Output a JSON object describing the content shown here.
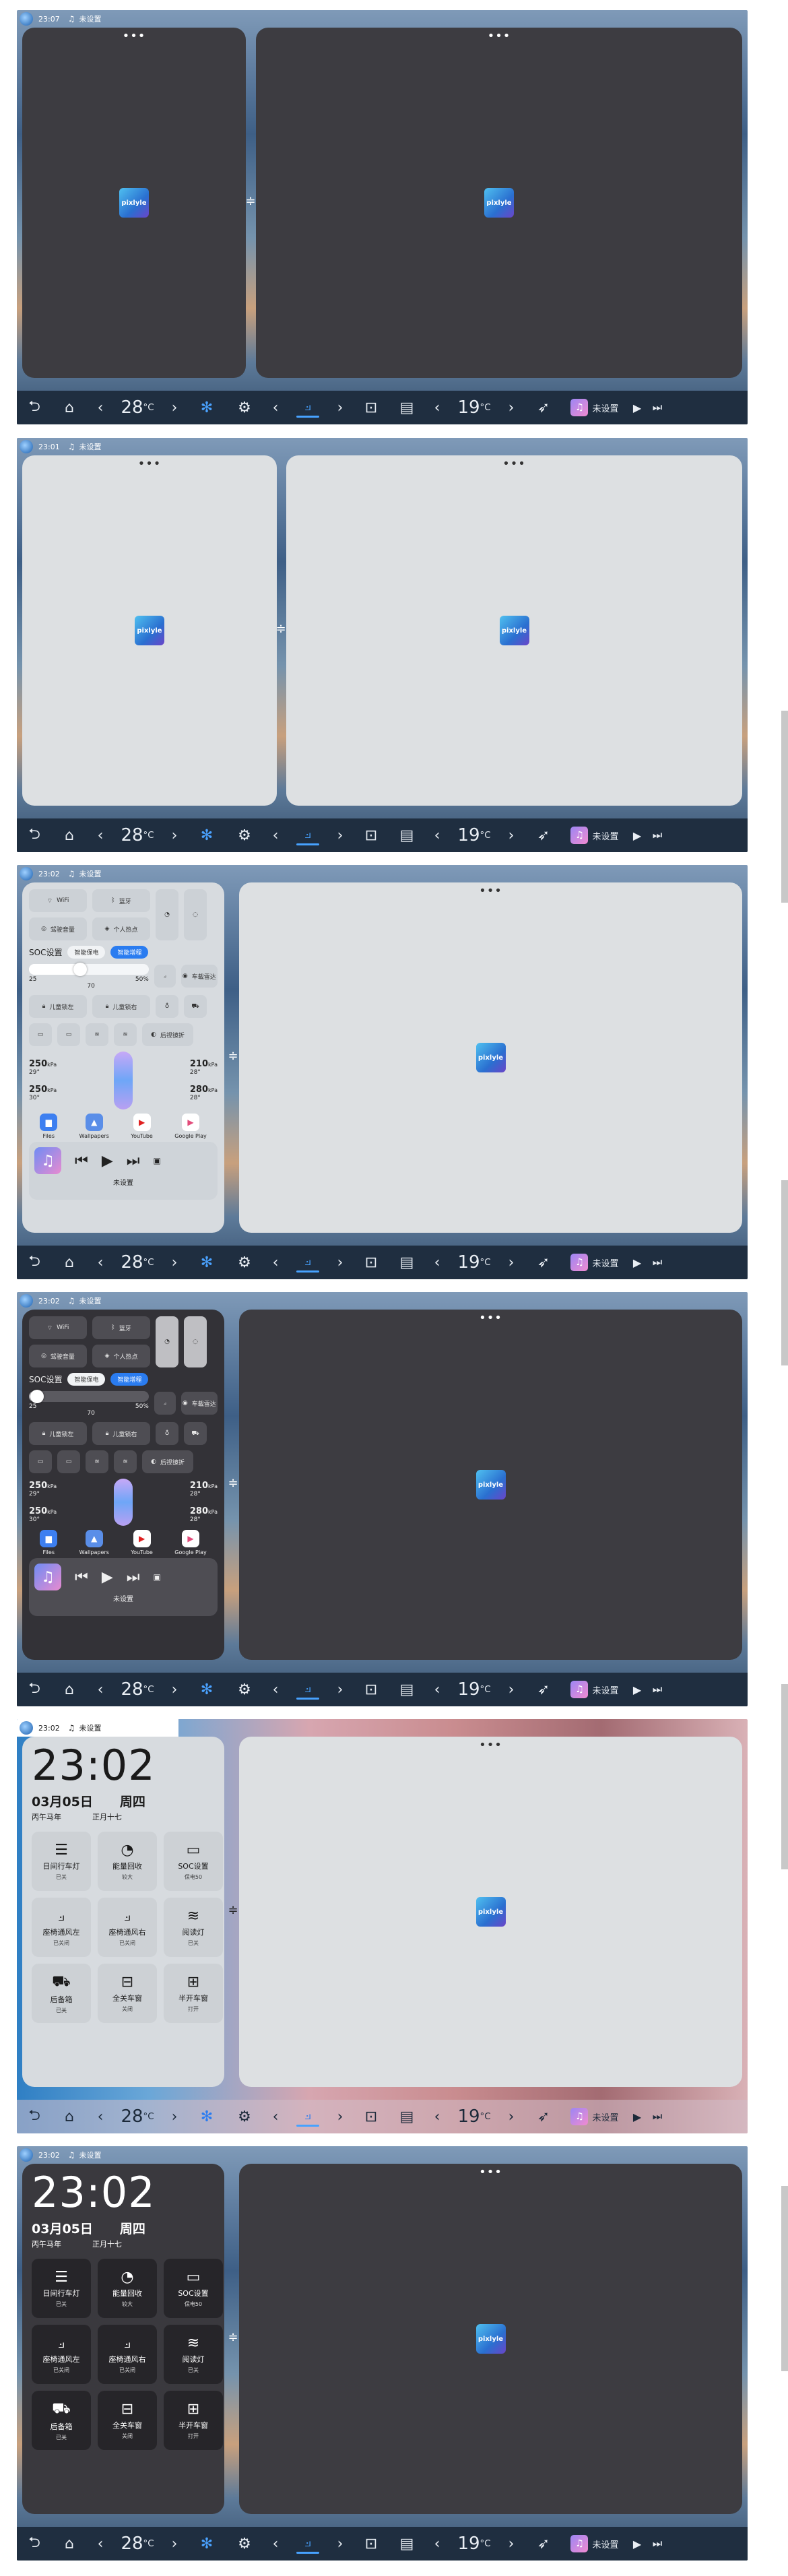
{
  "status": {
    "times": [
      "23:07",
      "23:01",
      "23:02",
      "23:02",
      "23:02",
      "23:02"
    ],
    "music_label": "未设置"
  },
  "app": {
    "icon_label": "pixlyle"
  },
  "divider": {
    "glyph": "≑"
  },
  "navbar": {
    "left_temp": "28",
    "right_temp": "19",
    "unit": "°C",
    "media_label": "未设置"
  },
  "quick": {
    "wifi": "WiFi",
    "bluetooth": "蓝牙",
    "t2": "驾驶音量",
    "t3": "个人热点",
    "soc_title": "SOC设置",
    "soc_opt1": "智能保电",
    "soc_opt2": "智能增程",
    "soc_value": "50%",
    "soc_min": "25",
    "soc_max": "70",
    "t4": "车载雷达",
    "child1": "儿童锁左",
    "child2": "儿童锁右",
    "t5": "后视镜折",
    "tyres": {
      "fl": "250",
      "fl_t": "29°",
      "fr": "210",
      "fr_t": "28°",
      "rl": "250",
      "rl_t": "30°",
      "rr": "280",
      "rr_t": "28°",
      "unit": "kPa"
    },
    "apps": [
      "Files",
      "Wallpapers",
      "YouTube",
      "Google Play"
    ],
    "media_caption": "未设置"
  },
  "clock": {
    "time": "23:02",
    "date": "03月05日",
    "weekday": "周四",
    "year": "丙午马年",
    "lunar": "正月十七",
    "tiles": [
      {
        "label": "日间行车灯",
        "sub": "已关"
      },
      {
        "label": "能量回收",
        "sub": "较大"
      },
      {
        "label": "SOC设置",
        "sub": "保电50"
      },
      {
        "label": "座椅通风左",
        "sub": "已关闭"
      },
      {
        "label": "座椅通风右",
        "sub": "已关闭"
      },
      {
        "label": "阅读灯",
        "sub": "已关"
      },
      {
        "label": "后备箱",
        "sub": "已关"
      },
      {
        "label": "全关车窗",
        "sub": "关闭"
      },
      {
        "label": "半开车窗",
        "sub": "打开"
      }
    ]
  },
  "icons": {
    "back": "back-arrow-icon",
    "home": "home-icon",
    "fan": "fan-icon",
    "settings": "gear-icon",
    "seat": "seat-heat-icon",
    "screen": "screen-icon",
    "window": "window-icon",
    "rocket": "launch-icon"
  }
}
